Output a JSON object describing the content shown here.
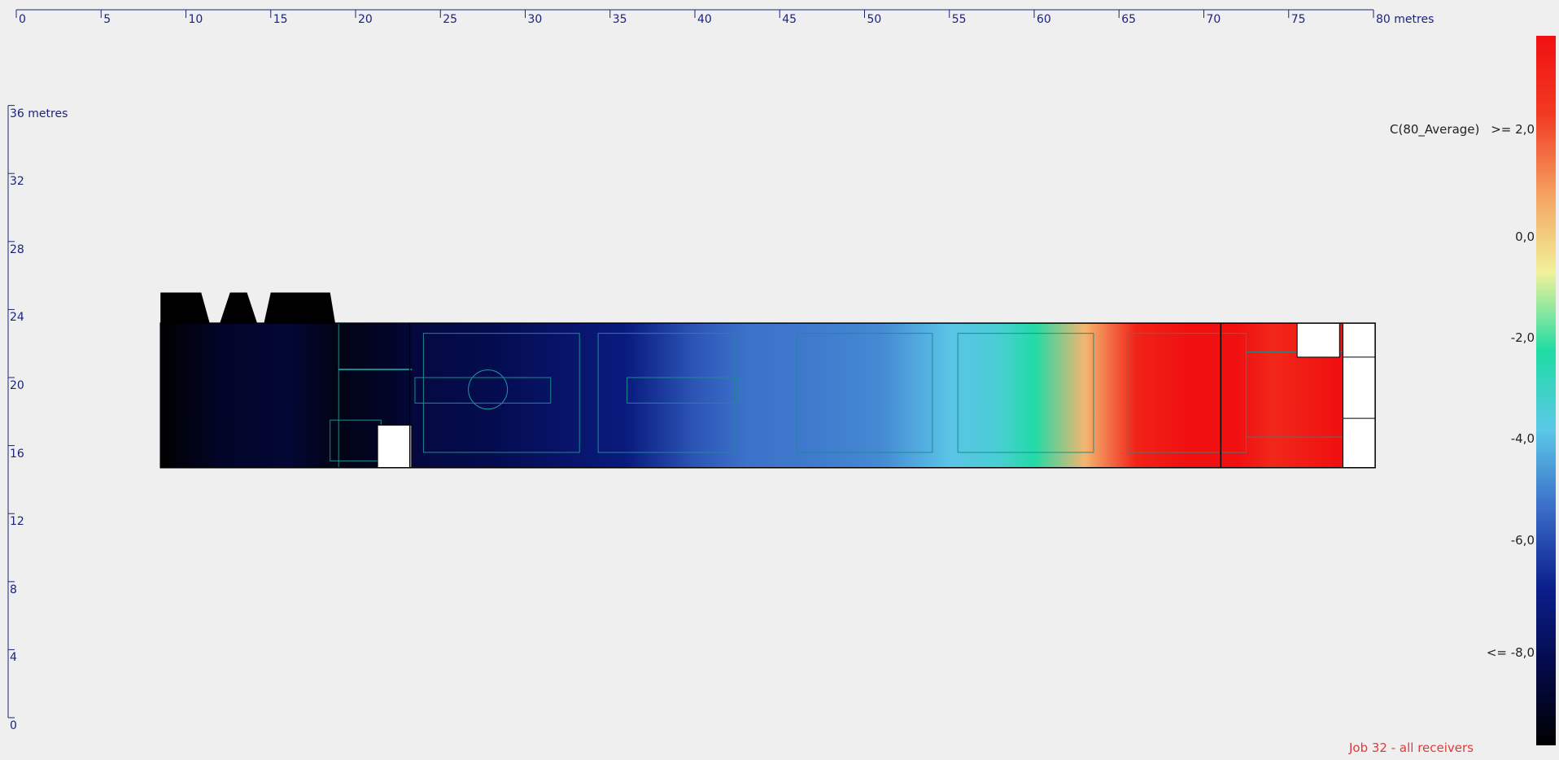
{
  "chart_data": {
    "type": "heatmap",
    "parameter_label": "C(80_Average)",
    "x_axis": {
      "ticks": [
        0,
        5,
        10,
        15,
        20,
        25,
        30,
        35,
        40,
        45,
        50,
        55,
        60,
        65,
        70,
        75,
        80
      ],
      "tick_labels": [
        "0",
        "5",
        "10",
        "15",
        "20",
        "25",
        "30",
        "35",
        "40",
        "45",
        "50",
        "55",
        "60",
        "65",
        "70",
        "75",
        "80 metres"
      ],
      "range": [
        0,
        80
      ]
    },
    "y_axis": {
      "ticks": [
        0,
        4,
        8,
        12,
        16,
        20,
        24,
        28,
        32,
        36
      ],
      "tick_labels": [
        "0",
        "4",
        "8",
        "12",
        "16",
        "20",
        "24",
        "28",
        "32",
        "36 metres"
      ],
      "range": [
        0,
        36
      ]
    },
    "color_scale": {
      "label_max": ">= 2,0",
      "label_min": "<= -8,0",
      "labels": [
        ">= 2,0",
        "0,0",
        "-2,0",
        "-4,0",
        "-6,0",
        "<= -8,0"
      ],
      "values": [
        2,
        0,
        -2,
        -4,
        -6,
        -8
      ],
      "range": [
        -8,
        2
      ],
      "colors": [
        "#000000",
        "#040a4a",
        "#0a1f8c",
        "#3a6cc8",
        "#5cc8e8",
        "#1edca4",
        "#f2f29a",
        "#f4a060",
        "#f23a22",
        "#f01010"
      ]
    },
    "field": {
      "extent_x": [
        8.5,
        79.5
      ],
      "extent_y": [
        14.7,
        23.2
      ],
      "columns_x": [
        8.5,
        12,
        16,
        19,
        22,
        24,
        28,
        32,
        36,
        40,
        43,
        47,
        51,
        55,
        58,
        60,
        63,
        66,
        69,
        72,
        74,
        78,
        79.5
      ],
      "values": [
        -8,
        -7.4,
        -7.2,
        -7.7,
        -7.4,
        -7,
        -6.8,
        -6.4,
        -6,
        -5,
        -4.6,
        -4.5,
        -4.3,
        -3.6,
        -3.2,
        -2.5,
        -0.5,
        1.5,
        2,
        2,
        1.4,
        2,
        2
      ]
    },
    "job_label": "Job 32 - all receivers"
  }
}
